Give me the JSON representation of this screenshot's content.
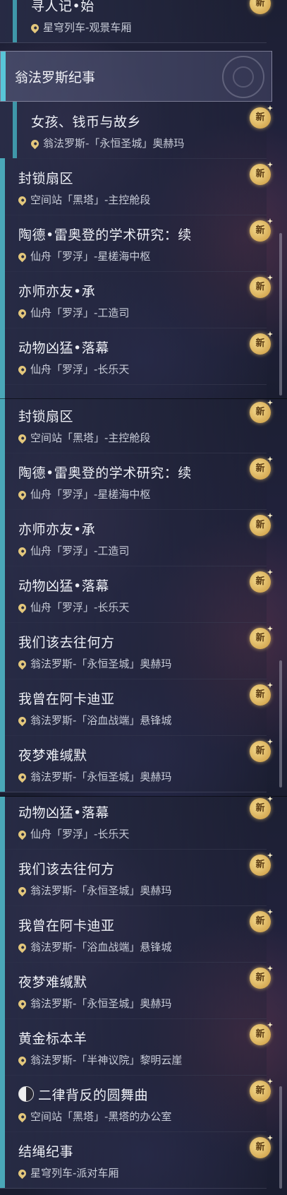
{
  "badge_label": "新",
  "panel1": {
    "top_mission": {
      "title": "寻人记•始",
      "location": "星穹列车-观景车厢"
    },
    "category": {
      "title": "翁法罗斯纪事"
    },
    "sub_mission": {
      "title": "女孩、钱币与故乡",
      "location": "翁法罗斯-「永恒圣城」奥赫玛"
    },
    "missions": [
      {
        "title": "封锁扇区",
        "location": "空间站「黑塔」-主控舱段"
      },
      {
        "title": "陶德•雷奥登的学术研究：续",
        "location": "仙舟「罗浮」-星槎海中枢"
      },
      {
        "title": "亦师亦友•承",
        "location": "仙舟「罗浮」-工造司"
      },
      {
        "title": "动物凶猛•落幕",
        "location": "仙舟「罗浮」-长乐天"
      }
    ]
  },
  "panel2": {
    "missions": [
      {
        "title": "封锁扇区",
        "location": "空间站「黑塔」-主控舱段"
      },
      {
        "title": "陶德•雷奥登的学术研究：续",
        "location": "仙舟「罗浮」-星槎海中枢"
      },
      {
        "title": "亦师亦友•承",
        "location": "仙舟「罗浮」-工造司"
      },
      {
        "title": "动物凶猛•落幕",
        "location": "仙舟「罗浮」-长乐天"
      },
      {
        "title": "我们该去往何方",
        "location": "翁法罗斯-「永恒圣城」奥赫玛"
      },
      {
        "title": "我曾在阿卡迪亚",
        "location": "翁法罗斯-「浴血战端」悬锋城"
      },
      {
        "title": "夜梦难缄默",
        "location": "翁法罗斯-「永恒圣城」奥赫玛"
      }
    ]
  },
  "panel3": {
    "missions": [
      {
        "title": "动物凶猛•落幕",
        "location": "仙舟「罗浮」-长乐天"
      },
      {
        "title": "我们该去往何方",
        "location": "翁法罗斯-「永恒圣城」奥赫玛"
      },
      {
        "title": "我曾在阿卡迪亚",
        "location": "翁法罗斯-「浴血战端」悬锋城"
      },
      {
        "title": "夜梦难缄默",
        "location": "翁法罗斯-「永恒圣城」奥赫玛"
      },
      {
        "title": "黄金标本羊",
        "location": "翁法罗斯-「半神议院」黎明云崖"
      },
      {
        "title": "二律背反的圆舞曲",
        "location": "空间站「黑塔」-黑塔的办公室"
      },
      {
        "title": "结绳纪事",
        "location": "星穹列车-派对车厢"
      }
    ]
  },
  "colors": {
    "accent_bar": "#4aa7b8",
    "badge_gold": "#e3b65a",
    "pin_gold": "#e3c77c"
  },
  "icons": {
    "location": "map-pin-icon",
    "new": "new-badge-icon",
    "special": "yin-yang-icon"
  }
}
